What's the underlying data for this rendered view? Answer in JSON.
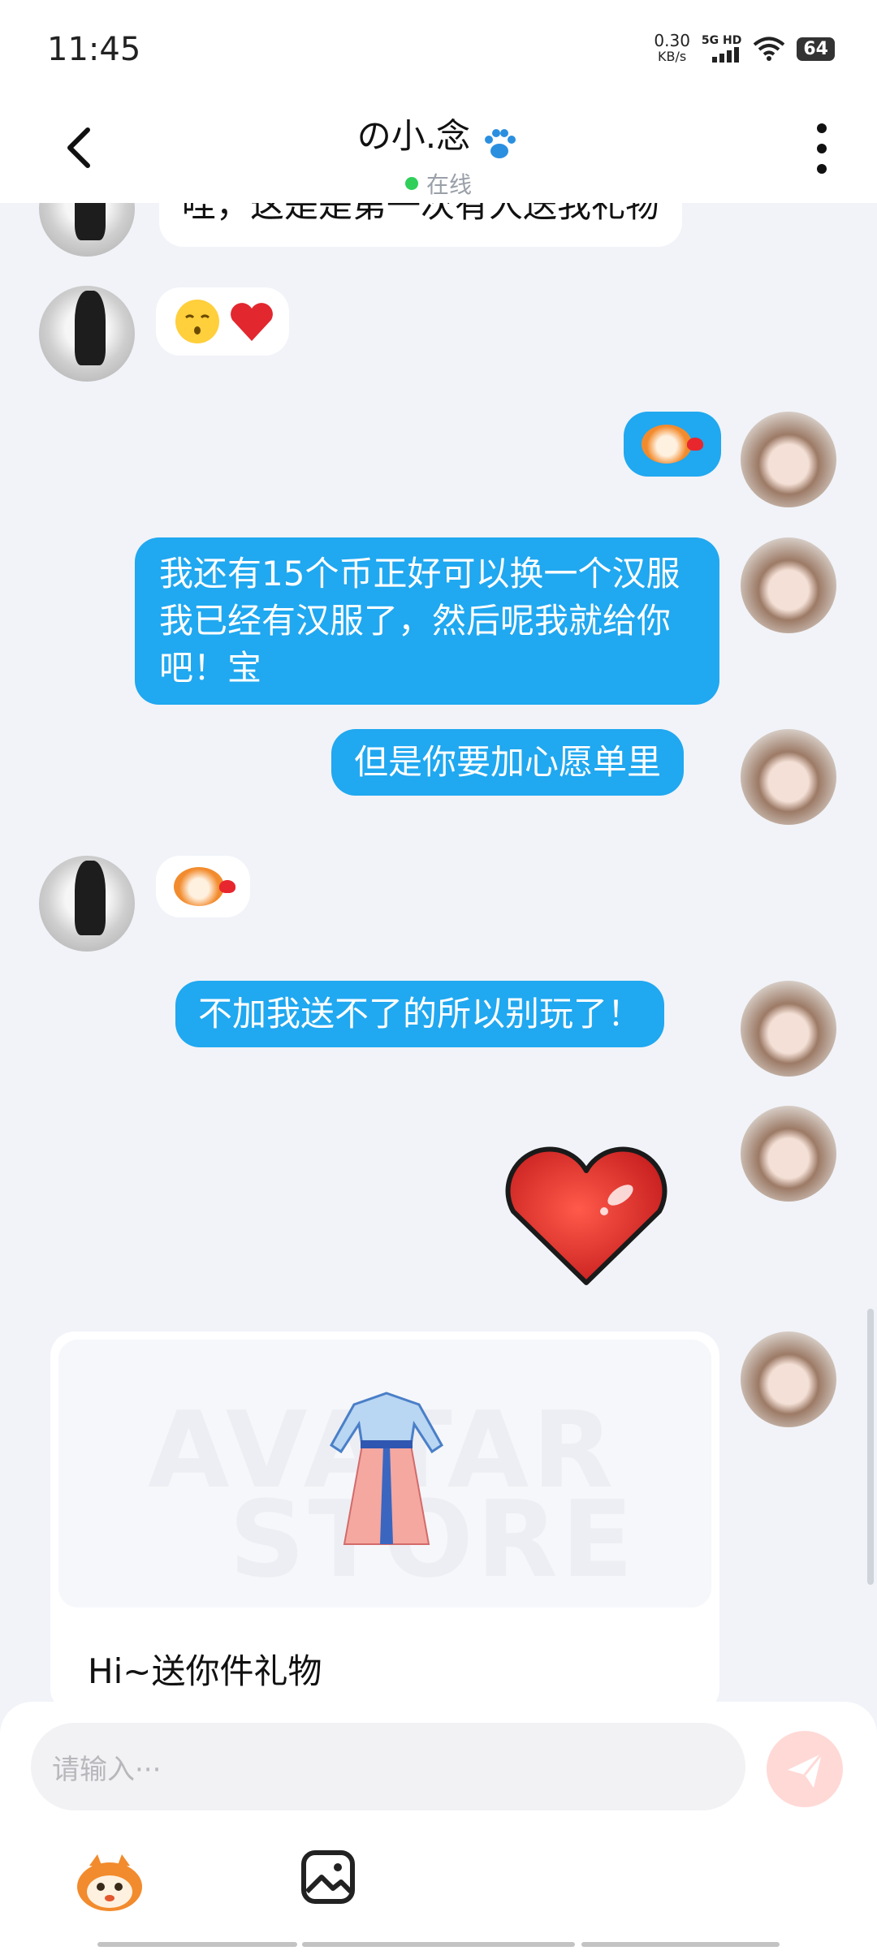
{
  "status_bar": {
    "time": "11:45",
    "speed_value": "0.30",
    "speed_unit": "KB/s",
    "network": "5G HD",
    "battery": "64"
  },
  "header": {
    "title": "の小.念",
    "presence": "在线"
  },
  "messages": [
    {
      "side": "left",
      "text": "哇，这是是第一次有人送我礼物"
    },
    {
      "side": "left",
      "icons": [
        "kissing-face-emoji",
        "red-heart-emoji"
      ]
    },
    {
      "side": "right",
      "icons": [
        "mascot-kiss-sticker"
      ]
    },
    {
      "side": "right",
      "text": "我还有15个币正好可以换一个汉服我已经有汉服了，然后呢我就给你吧！宝"
    },
    {
      "side": "right",
      "text": "但是你要加心愿单里"
    },
    {
      "side": "left",
      "icons": [
        "mascot-kiss-sticker"
      ]
    },
    {
      "side": "right",
      "text": "不加我送不了的所以别玩了！"
    },
    {
      "side": "right",
      "icons": [
        "big-heart-sticker"
      ]
    }
  ],
  "gift_card": {
    "watermark_line1": "AVATAR",
    "watermark_line2": "STORE",
    "text": "Hi~送你件礼物"
  },
  "input": {
    "placeholder": "请输入···"
  },
  "colors": {
    "bubble_right": "#20a8f0",
    "bubble_left": "#ffffff",
    "background": "#f1f3f8",
    "online_dot": "#2fcf5a"
  }
}
